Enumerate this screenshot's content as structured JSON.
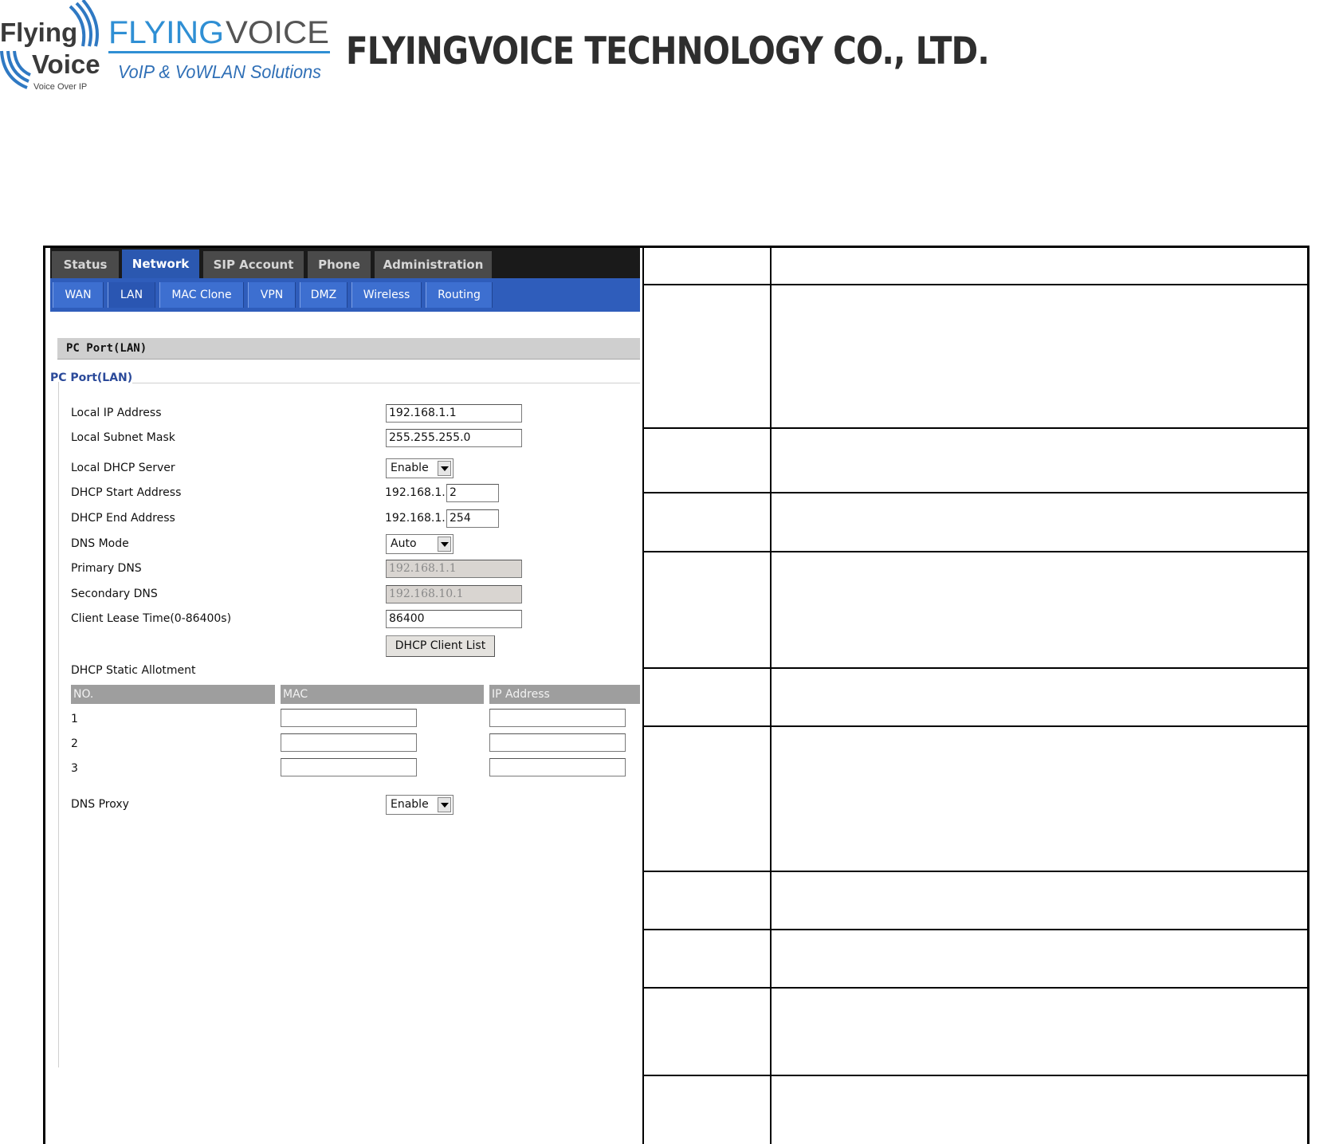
{
  "header": {
    "company_name": "FLYINGVOICE TECHNOLOGY CO., LTD.",
    "logo_left": {
      "line1": "Flying",
      "line2": "Voice",
      "tagline": "Voice Over IP"
    },
    "logo_brand": {
      "name_part1": "FLYING",
      "name_part2": "VOICE",
      "tagline": "VoIP & VoWLAN Solutions"
    }
  },
  "router": {
    "main_tabs": [
      {
        "label": "Status",
        "active": false
      },
      {
        "label": "Network",
        "active": true
      },
      {
        "label": "SIP Account",
        "active": false
      },
      {
        "label": "Phone",
        "active": false
      },
      {
        "label": "Administration",
        "active": false
      }
    ],
    "sub_tabs": [
      {
        "label": "WAN",
        "active": false
      },
      {
        "label": "LAN",
        "active": true
      },
      {
        "label": "MAC Clone",
        "active": false
      },
      {
        "label": "VPN",
        "active": false
      },
      {
        "label": "DMZ",
        "active": false
      },
      {
        "label": "Wireless",
        "active": false
      },
      {
        "label": "Routing",
        "active": false
      }
    ],
    "section_title": "PC Port(LAN)",
    "legend_title": "PC Port(LAN)",
    "fields": {
      "local_ip": {
        "label": "Local IP Address",
        "value": "192.168.1.1"
      },
      "subnet_mask": {
        "label": "Local Subnet Mask",
        "value": "255.255.255.0"
      },
      "dhcp_server": {
        "label": "Local DHCP Server",
        "value": "Enable"
      },
      "dhcp_start": {
        "label": "DHCP Start Address",
        "prefix": "192.168.1.",
        "value": "2"
      },
      "dhcp_end": {
        "label": "DHCP End Address",
        "prefix": "192.168.1.",
        "value": "254"
      },
      "dns_mode": {
        "label": "DNS Mode",
        "value": "Auto"
      },
      "primary_dns": {
        "label": "Primary DNS",
        "value": "192.168.1.1"
      },
      "secondary_dns": {
        "label": "Secondary DNS",
        "value": "192.168.10.1"
      },
      "lease_time": {
        "label": "Client Lease Time(0-86400s)",
        "value": "86400"
      },
      "dhcp_client_list_button": "DHCP Client List",
      "static_allotment_label": "DHCP Static Allotment",
      "static_headers": [
        "NO.",
        "MAC",
        "IP Address"
      ],
      "static_rows": [
        {
          "no": "1",
          "mac": "",
          "ip": ""
        },
        {
          "no": "2",
          "mac": "",
          "ip": ""
        },
        {
          "no": "3",
          "mac": "",
          "ip": ""
        }
      ],
      "dns_proxy": {
        "label": "DNS Proxy",
        "value": "Enable"
      }
    }
  }
}
